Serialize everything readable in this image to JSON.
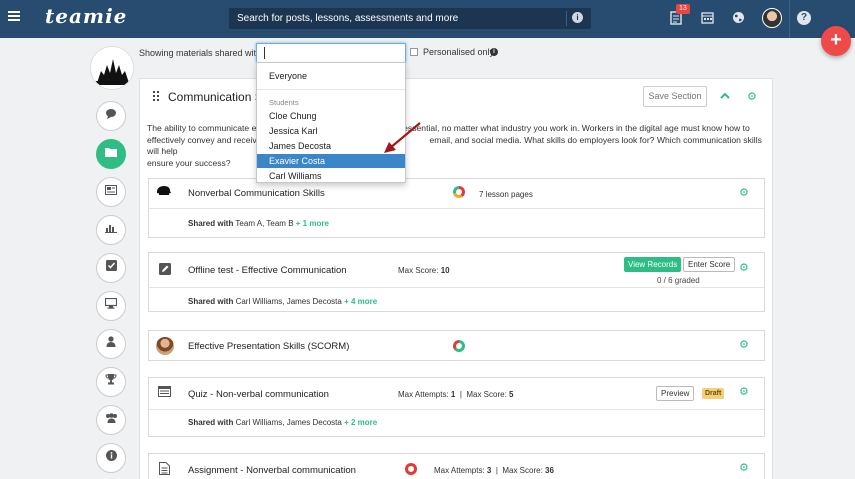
{
  "topbar": {
    "logo": "teamie",
    "search_placeholder": "Search for posts, lessons, assessments and more",
    "notification_count": "13"
  },
  "filter": {
    "label": "Showing materials shared with",
    "value": "",
    "personalised_label": "Personalised only"
  },
  "dropdown": {
    "everyone": "Everyone",
    "group_label": "Students",
    "students": [
      "Cloe Chung",
      "Jessica Karl",
      "James Decosta",
      "Exavier Costa",
      "Carl Williams"
    ],
    "selected": "Exavier Costa"
  },
  "section": {
    "title": "Communication S",
    "save_label": "Save Section",
    "description": "The ability to communicate ef... is essential, no matter what industry you work in. Workers in the digital age must know how to effectively convey and receive ... email, and social media. What skills do employers look for? Which communication skills will help ensure your success?",
    "desc_line1_a": "The ability to communicate ef",
    "desc_line1_b": "t is essential, no matter what industry you work in. Workers in the digital age must know how to",
    "desc_line2_a": "effectively convey and receive",
    "desc_line2_b": "email, and social media. What skills do employers look for? Which communication skills will help",
    "desc_line3": "ensure your success?"
  },
  "items": [
    {
      "title": "Nonverbal Communication Skills",
      "meta": "7 lesson pages",
      "shared_label": "Shared with",
      "shared_names": "Team A, Team B",
      "shared_more": "+ 1 more"
    },
    {
      "title": "Offline test - Effective Communication",
      "meta_label": "Max Score:",
      "meta_value": "10",
      "view_records": "View Records",
      "enter_score": "Enter Score",
      "graded": "0 / 6 graded",
      "shared_label": "Shared with",
      "shared_names": "Carl Williams, James Decosta",
      "shared_more": "+ 4 more"
    },
    {
      "title": "Effective Presentation Skills (SCORM)"
    },
    {
      "title": "Quiz - Non-verbal communication",
      "attempts_label": "Max Attempts:",
      "attempts_value": "1",
      "score_label": "Max Score:",
      "score_value": "5",
      "preview": "Preview",
      "status": "Draft",
      "shared_label": "Shared with",
      "shared_names": "Carl Williams, James Decosta",
      "shared_more": "+ 2 more"
    },
    {
      "title": "Assignment - Nonverbal communication",
      "attempts_label": "Max Attempts:",
      "attempts_value": "3",
      "score_label": "Max Score:",
      "score_value": "36"
    }
  ],
  "colors": {
    "topbar": "#274c70",
    "accent_green": "#2ebd85",
    "fab_red": "#ef4a4a",
    "selection_blue": "#3b86c8",
    "draft_yellow": "#f3cf7a"
  },
  "icons": {
    "menu": "hamburger-icon",
    "info": "info-icon",
    "notifications": "document-icon",
    "calendar": "calendar-icon",
    "globe": "globe-icon",
    "help": "help-icon",
    "add": "plus-icon"
  }
}
